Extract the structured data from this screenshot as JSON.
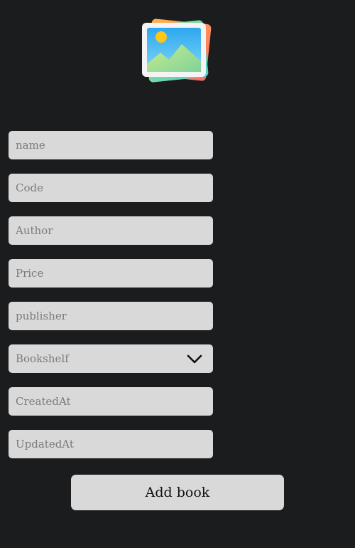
{
  "image_placeholder": {
    "icon": "image-placeholder-icon"
  },
  "form": {
    "fields": [
      {
        "placeholder": "name"
      },
      {
        "placeholder": "Code"
      },
      {
        "placeholder": "Author"
      },
      {
        "placeholder": "Price"
      },
      {
        "placeholder": "publisher"
      }
    ],
    "bookshelf": {
      "placeholder": "Bookshelf",
      "icon": "chevron-down-icon"
    },
    "created_at": {
      "placeholder": "CreatedAt"
    },
    "updated_at": {
      "placeholder": "UpdatedAt"
    },
    "submit_label": "Add book"
  },
  "colors": {
    "background": "#1b1c1e",
    "field": "#d9d9d9",
    "placeholder_text": "#7b7b7b"
  }
}
